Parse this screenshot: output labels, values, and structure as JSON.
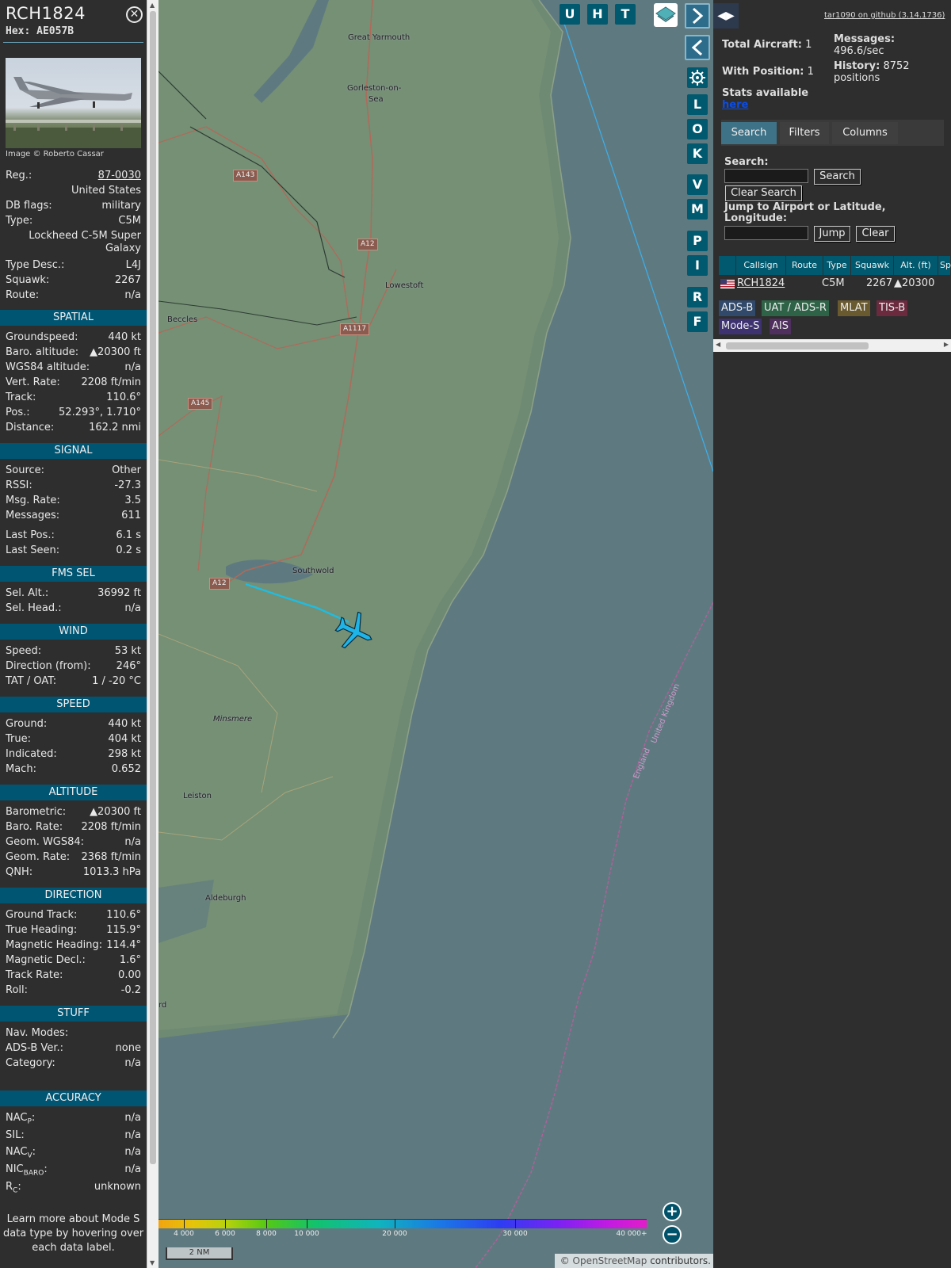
{
  "info": {
    "callsign": "RCH1824",
    "hex": "Hex: AE057B",
    "photo_credit": "Image © Roberto Cassar",
    "reg_label": "Reg.:",
    "reg_value": "87-0030",
    "country": "United States",
    "dbflags_label": "DB flags:",
    "dbflags_value": "military",
    "type_label": "Type:",
    "type_value": "C5M",
    "type_name": "Lockheed C-5M Super Galaxy",
    "typedesc_label": "Type Desc.:",
    "typedesc_value": "L4J",
    "squawk_label": "Squawk:",
    "squawk_value": "2267",
    "route_label": "Route:",
    "route_value": "n/a",
    "spatial": {
      "title": "SPATIAL",
      "groundspeed_label": "Groundspeed:",
      "groundspeed_value": "440 kt",
      "baro_label": "Baro. altitude:",
      "baro_value": "▲20300 ft",
      "wgs_label": "WGS84 altitude:",
      "wgs_value": "n/a",
      "vert_label": "Vert. Rate:",
      "vert_value": "2208 ft/min",
      "track_label": "Track:",
      "track_value": "110.6°",
      "pos_label": "Pos.:",
      "pos_value": "52.293°, 1.710°",
      "dist_label": "Distance:",
      "dist_value": "162.2 nmi"
    },
    "signal": {
      "title": "SIGNAL",
      "source_label": "Source:",
      "source_value": "Other",
      "rssi_label": "RSSI:",
      "rssi_value": "-27.3",
      "msgrate_label": "Msg. Rate:",
      "msgrate_value": "3.5",
      "messages_label": "Messages:",
      "messages_value": "611",
      "lastpos_label": "Last Pos.:",
      "lastpos_value": "6.1 s",
      "lastseen_label": "Last Seen:",
      "lastseen_value": "0.2 s"
    },
    "fms": {
      "title": "FMS SEL",
      "selalt_label": "Sel. Alt.:",
      "selalt_value": "36992 ft",
      "selhead_label": "Sel. Head.:",
      "selhead_value": "n/a"
    },
    "wind": {
      "title": "WIND",
      "speed_label": "Speed:",
      "speed_value": "53 kt",
      "dir_label": "Direction (from):",
      "dir_value": "246°",
      "tat_label": "TAT / OAT:",
      "tat_value": "1 / -20 °C"
    },
    "speed": {
      "title": "SPEED",
      "ground_label": "Ground:",
      "ground_value": "440 kt",
      "true_label": "True:",
      "true_value": "404 kt",
      "ind_label": "Indicated:",
      "ind_value": "298 kt",
      "mach_label": "Mach:",
      "mach_value": "0.652"
    },
    "altitude": {
      "title": "ALTITUDE",
      "baro_label": "Barometric:",
      "baro_value": "▲20300 ft",
      "barorate_label": "Baro. Rate:",
      "barorate_value": "2208 ft/min",
      "geom_label": "Geom. WGS84:",
      "geom_value": "n/a",
      "geomrate_label": "Geom. Rate:",
      "geomrate_value": "2368 ft/min",
      "qnh_label": "QNH:",
      "qnh_value": "1013.3 hPa"
    },
    "direction": {
      "title": "DIRECTION",
      "gtrack_label": "Ground Track:",
      "gtrack_value": "110.6°",
      "thead_label": "True Heading:",
      "thead_value": "115.9°",
      "mhead_label": "Magnetic Heading:",
      "mhead_value": "114.4°",
      "mdecl_label": "Magnetic Decl.:",
      "mdecl_value": "1.6°",
      "trate_label": "Track Rate:",
      "trate_value": "0.00",
      "roll_label": "Roll:",
      "roll_value": "-0.2"
    },
    "stuff": {
      "title": "STUFF",
      "nav_label": "Nav. Modes:",
      "nav_value": "",
      "adsb_label": "ADS-B Ver.:",
      "adsb_value": "none",
      "cat_label": "Category:",
      "cat_value": "n/a"
    },
    "accuracy": {
      "title": "ACCURACY",
      "nacp_label": "NAC",
      "nacp_sub": "P",
      "nacp_value": "n/a",
      "sil_label": "SIL:",
      "sil_value": "n/a",
      "nacv_label": "NAC",
      "nacv_sub": "V",
      "nacv_value": "n/a",
      "nic_label": "NIC",
      "nic_sub": "BARO",
      "nic_value": "n/a",
      "rc_label": "R",
      "rc_sub": "C",
      "rc_value": "unknown"
    },
    "learn_more": "Learn more about Mode S data type by hovering over each data label."
  },
  "map": {
    "towns": [
      "Great Yarmouth",
      "Gorleston-on-",
      "Sea",
      "Lowestoft",
      "Beccles",
      "Southwold",
      "Minsmere",
      "Leiston",
      "Aldeburgh",
      "rd"
    ],
    "roads": [
      "A143",
      "A12",
      "A1117",
      "A145",
      "A12"
    ],
    "border_labels": [
      "United Kingdom",
      "England"
    ],
    "tools_top": [
      "U",
      "H",
      "T"
    ],
    "tools_side": [
      "L",
      "O",
      "K",
      "V",
      "M",
      "P",
      "I",
      "R",
      "F"
    ],
    "next_icon": "chevron-right-icon",
    "prev_icon": "chevron-left-icon",
    "legend_labels": [
      "4 000",
      "6 000",
      "8 000",
      "10 000",
      "20 000",
      "30 000",
      "40 000+"
    ],
    "scale_label": "2 NM",
    "zoom_in": "+",
    "zoom_out": "−",
    "attribution_prefix": "© ",
    "attribution_link": "OpenStreetMap",
    "attribution_suffix": " contributors."
  },
  "side": {
    "github_link": "tar1090 on github (3.14.1736)",
    "total_label": "Total Aircraft:",
    "total_value": "1",
    "withpos_label": "With Position:",
    "withpos_value": "1",
    "messages_label": "Messages:",
    "messages_value": "496.6/sec",
    "history_label": "History:",
    "history_value": "8752 positions",
    "stats_label": "Stats available",
    "stats_link": "here",
    "tabs": [
      "Search",
      "Filters",
      "Columns"
    ],
    "search_label": "Search:",
    "search_button": "Search",
    "clear_search_button": "Clear Search",
    "jump_label": "Jump to Airport or Latitude, Longitude:",
    "jump_button": "Jump",
    "clear_button": "Clear",
    "table_headers": [
      "Callsign",
      "Route",
      "Type",
      "Squawk",
      "Alt. (ft)",
      "Sp"
    ],
    "row": {
      "callsign": "RCH1824",
      "route": "",
      "type": "C5M",
      "squawk": "2267",
      "alt": "▲20300"
    },
    "badges": [
      "ADS-B",
      "UAT / ADS-R",
      "MLAT",
      "TIS-B",
      "Mode-S",
      "AIS"
    ]
  },
  "colors": {
    "section_bg": "#005573",
    "tool_bg": "#00596e",
    "aircraft": "#1fb4e8",
    "track_line": "#1fb4e8",
    "active_tab": "#3e7287"
  }
}
